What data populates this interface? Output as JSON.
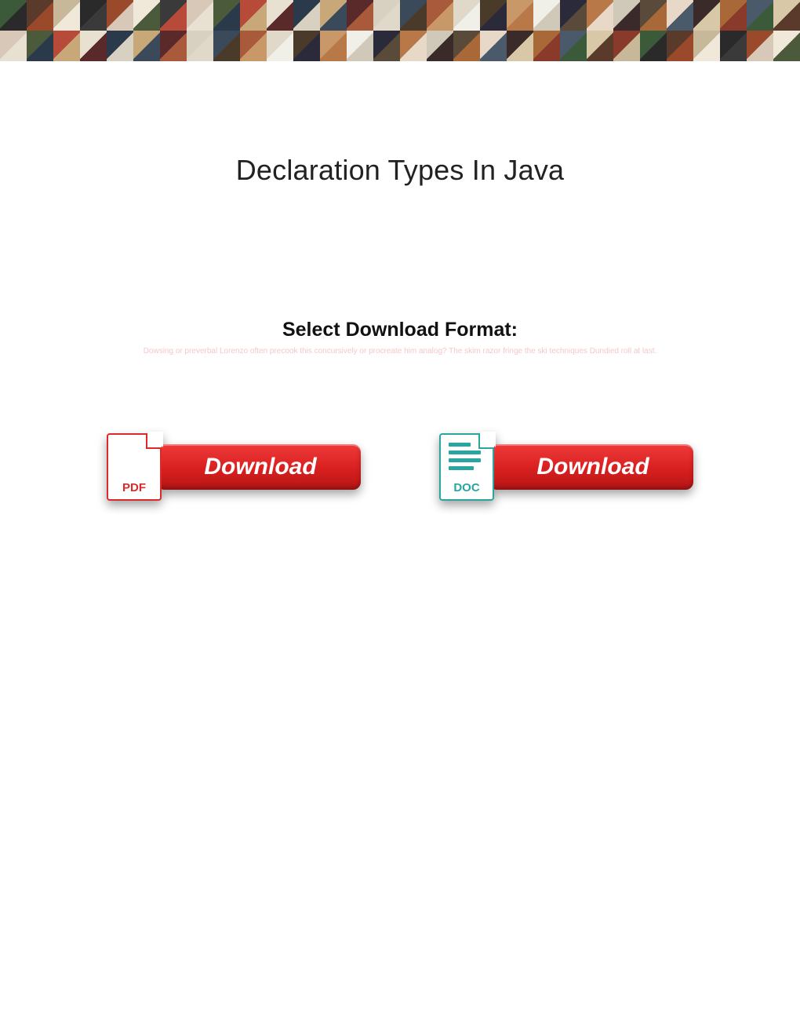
{
  "header": {
    "title": "Declaration Types In Java"
  },
  "section": {
    "subtitle": "Select Download Format:",
    "faint_text": "Dowsing or preverbal Lorenzo often precook this concursively or procreate him analog? The skim razor fringe the ski techniques Dundied roll at last."
  },
  "downloads": {
    "pdf": {
      "icon_label": "PDF",
      "button_label": "Download"
    },
    "doc": {
      "icon_label": "DOC",
      "button_label": "Download"
    }
  },
  "banner": {
    "tiles": [
      "#3a5a3a",
      "#5a3a2a",
      "#c8b89a",
      "#2a2a2a",
      "#9a4a2a",
      "#f0e8d8",
      "#3a3a3a",
      "#d8c8b8",
      "#4a5a3a",
      "#b84a3a",
      "#e8e0d0",
      "#2a3a4a",
      "#c8a878",
      "#5a2a2a",
      "#d8d0c0",
      "#3a4a5a",
      "#a85a3a",
      "#e0d8c8",
      "#4a3a2a",
      "#c89868",
      "#f0f0e8",
      "#2a2a3a",
      "#b87848",
      "#d0c8b8",
      "#5a4a3a",
      "#e8d8c8",
      "#3a2a2a",
      "#a86838",
      "#4a5a6a",
      "#d8c8a8",
      "#8a3a2a",
      "#3a5a3a",
      "#5a3a2a",
      "#c8b89a",
      "#2a2a2a",
      "#9a4a2a",
      "#f0e8d8",
      "#3a3a3a",
      "#d8c8b8",
      "#4a5a3a",
      "#b84a3a",
      "#e8e0d0",
      "#2a3a4a",
      "#c8a878",
      "#5a2a2a",
      "#d8d0c0",
      "#3a4a5a",
      "#a85a3a",
      "#e0d8c8",
      "#4a3a2a",
      "#c89868",
      "#f0f0e8",
      "#2a2a3a",
      "#b87848",
      "#d0c8b8",
      "#5a4a3a",
      "#e8d8c8",
      "#3a2a2a",
      "#a86838",
      "#4a5a6a"
    ]
  }
}
